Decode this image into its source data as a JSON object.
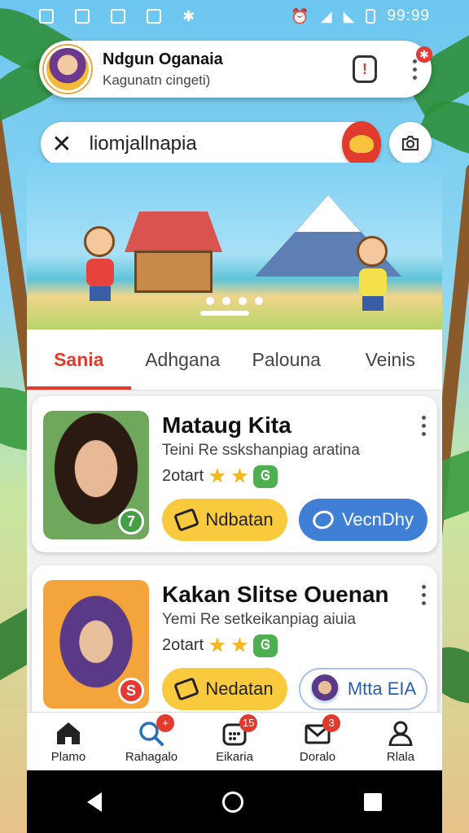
{
  "status_bar": {
    "time": "99:99"
  },
  "profile": {
    "name": "Ndgun Oganaia",
    "subtitle": "Kagunatn cingeti)",
    "alert_symbol": "!",
    "gear_symbol": "✱"
  },
  "search": {
    "value": "liomjallnapia"
  },
  "tabs": [
    {
      "label": "Sania",
      "active": true
    },
    {
      "label": "Adhgana",
      "active": false
    },
    {
      "label": "Palouna",
      "active": false
    },
    {
      "label": "Veinis",
      "active": false
    }
  ],
  "cards": [
    {
      "title": "Mataug Kita",
      "description": "Teini Re sskshanpiag aratina",
      "meta": "2otart",
      "badge": "7",
      "badge_color": "#43a047",
      "tag": "Ꮆ",
      "primary_button": "Ndbatan",
      "secondary_button": "VecnDhy"
    },
    {
      "title": "Kakan Slitse Ouenan",
      "description": "Yemi Re setkeikanpiag aiuia",
      "meta": "2otart",
      "badge": "S",
      "badge_color": "#e53935",
      "tag": "Ꮆ",
      "primary_button": "Nedatan",
      "secondary_button": "Mtta  EIA"
    }
  ],
  "stars": "★",
  "bottom_nav": [
    {
      "label": "Plamo",
      "icon": "home-icon",
      "badge": ""
    },
    {
      "label": "Rahagalo",
      "icon": "search-icon",
      "badge": "+"
    },
    {
      "label": "Eikaria",
      "icon": "calendar-icon",
      "badge": "15"
    },
    {
      "label": "Doralo",
      "icon": "mail-icon",
      "badge": "3"
    },
    {
      "label": "Rlala",
      "icon": "person-icon",
      "badge": ""
    }
  ],
  "colors": {
    "accent": "#e23b2e",
    "primary_button": "#f9c93e",
    "secondary_button": "#3f7fd6"
  }
}
